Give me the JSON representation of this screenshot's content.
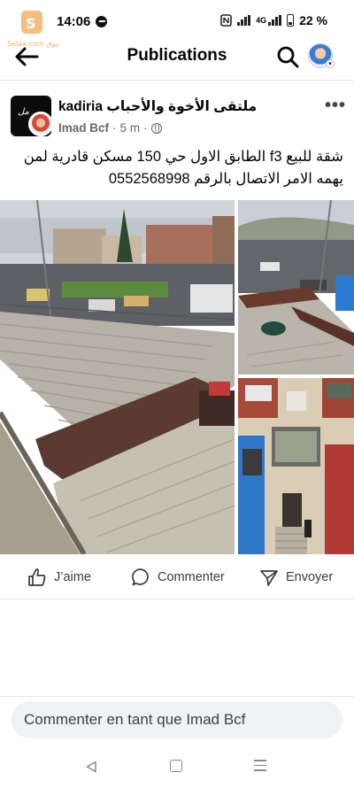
{
  "status_bar": {
    "time": "14:06",
    "battery": "22 %",
    "network": "4G",
    "watermark_text": "Selaa.com سوق"
  },
  "header": {
    "title": "Publications"
  },
  "post": {
    "group_name": "ملتقى الأخوة والأحباب kadiria",
    "author": "Imad Bcf",
    "time": "5 m",
    "meta_separator": "·",
    "text": "شقة للبيع f3 الطابق الاول حي 150 مسكن قادرية لمن يهمه الامر الاتصال بالرقم 0552568998",
    "group_avatar_tag": "مل"
  },
  "actions": {
    "like_label": "J’aime",
    "comment_label": "Commenter",
    "share_label": "Envoyer"
  },
  "comment_box": {
    "placeholder": "Commenter en tant que Imad Bcf"
  },
  "icons": {
    "back": "arrow-left-icon",
    "search": "search-icon",
    "more": "more-horizontal-icon",
    "audience": "globe-icon",
    "like": "thumbs-up-icon",
    "comment": "speech-bubble-icon",
    "share": "send-icon"
  },
  "colors": {
    "text_primary": "#050505",
    "text_secondary": "#65676b",
    "divider": "#e4e6eb",
    "input_bg": "#f0f2f5"
  }
}
